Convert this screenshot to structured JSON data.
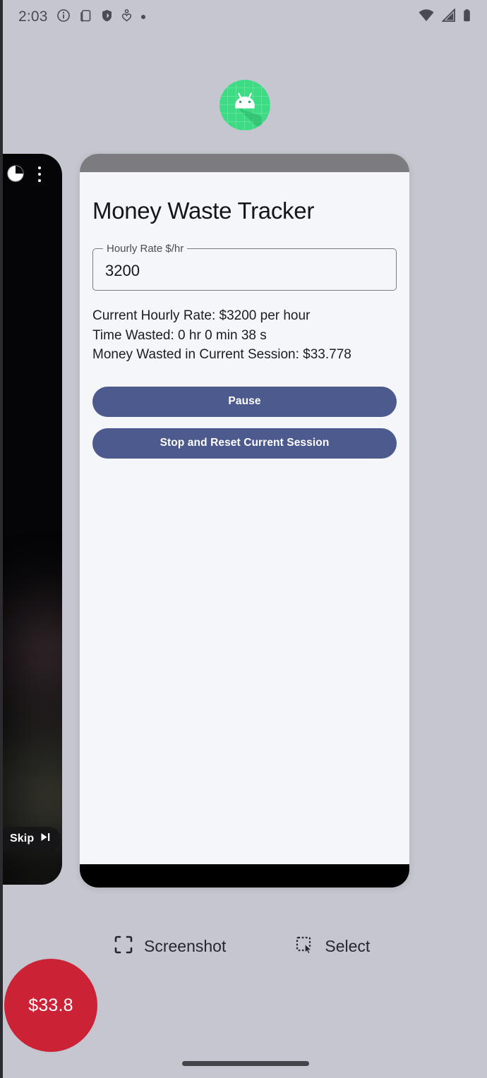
{
  "status_bar": {
    "time": "2:03",
    "left_icons": [
      "info-icon",
      "screenshot-icon",
      "shield-icon",
      "heart-monitor-icon",
      "dot-icon"
    ],
    "right_icons": [
      "wifi-icon",
      "cellular-signal-icon",
      "battery-icon"
    ]
  },
  "launcher": {
    "app_icon_name": "android-app-icon",
    "icon_color": "#3ddc84"
  },
  "media_panel": {
    "pie_icon_name": "pie-chart-icon",
    "overflow_icon_name": "more-vertical-icon",
    "skip_label": "Skip",
    "skip_icon_name": "skip-next-icon"
  },
  "app": {
    "title": "Money Waste Tracker",
    "field": {
      "label": "Hourly Rate $/hr",
      "value": "3200"
    },
    "stats": [
      "Current Hourly Rate: $3200 per hour",
      "Time Wasted: 0 hr 0 min 38 s",
      "Money Wasted in Current Session: $33.778"
    ],
    "buttons": {
      "pause": "Pause",
      "stop_reset": "Stop and Reset Current Session"
    },
    "accent_color": "#4d5a8d",
    "surface_color": "#f5f6fa"
  },
  "action_bar": {
    "screenshot_label": "Screenshot",
    "screenshot_icon_name": "crop-frame-icon",
    "select_label": "Select",
    "select_icon_name": "select-cursor-icon"
  },
  "overlay_bubble": {
    "amount": "$33.8",
    "color": "#cc2236"
  },
  "system": {
    "background_color": "#c5c6d0",
    "home_indicator": "home-gesture-bar"
  }
}
